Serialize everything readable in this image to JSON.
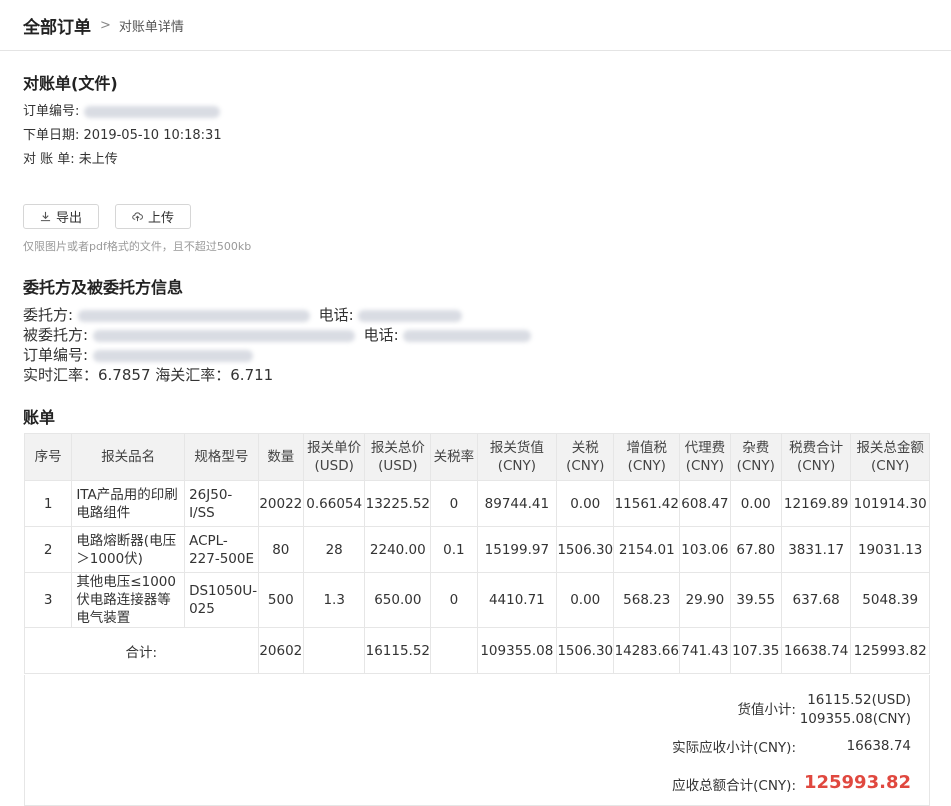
{
  "breadcrumb": {
    "root": "全部订单",
    "separator": ">",
    "current": "对账单详情"
  },
  "statement": {
    "title": "对账单(文件)",
    "order_no_label": "订单编号:",
    "order_date_label": "下单日期:",
    "order_date": "2019-05-10 10:18:31",
    "statement_label": "对 账 单:",
    "statement_status": "未上传",
    "export_label": "导出",
    "upload_label": "上传",
    "hint": "仅限图片或者pdf格式的文件，且不超过500kb"
  },
  "parties": {
    "title": "委托方及被委托方信息",
    "client_label": "委托方:",
    "client_phone_label": "电话:",
    "agent_label": "被委托方:",
    "agent_phone_label": "电话:",
    "order_no_label": "订单编号:",
    "rates": "实时汇率：6.7857  海关汇率：6.711"
  },
  "bill": {
    "title": "账单",
    "headers": [
      "序号",
      "报关品名",
      "规格型号",
      "数量",
      "报关单价(USD)",
      "报关总价(USD)",
      "关税率",
      "报关货值(CNY)",
      "关税(CNY)",
      "增值税(CNY)",
      "代理费(CNY)",
      "杂费(CNY)",
      "税费合计(CNY)",
      "报关总金额(CNY)"
    ],
    "rows": [
      [
        "1",
        "ITA产品用的印刷电路组件",
        "26J50-I/SS",
        "20022",
        "0.66054",
        "13225.52",
        "0",
        "89744.41",
        "0.00",
        "11561.42",
        "608.47",
        "0.00",
        "12169.89",
        "101914.30"
      ],
      [
        "2",
        "电路熔断器(电压＞1000伏)",
        "ACPL-227-500E",
        "80",
        "28",
        "2240.00",
        "0.1",
        "15199.97",
        "1506.30",
        "2154.01",
        "103.06",
        "67.80",
        "3831.17",
        "19031.13"
      ],
      [
        "3",
        "其他电压≤1000伏电路连接器等电气装置",
        "DS1050U-025",
        "500",
        "1.3",
        "650.00",
        "0",
        "4410.71",
        "0.00",
        "568.23",
        "29.90",
        "39.55",
        "637.68",
        "5048.39"
      ]
    ],
    "total_label": "合计:",
    "totals": {
      "qty": "20602",
      "total_usd": "16115.52",
      "goods_cny": "109355.08",
      "duty": "1506.30",
      "vat": "14283.66",
      "agency": "741.43",
      "misc": "107.35",
      "tax_total": "16638.74",
      "grand": "125993.82"
    }
  },
  "summary": {
    "goods_label": "货值小计:",
    "goods_usd": "16115.52(USD)",
    "goods_cny": "109355.08(CNY)",
    "receivable_label": "实际应收小计(CNY):",
    "receivable": "16638.74",
    "total_label": "应收总额合计(CNY):",
    "total": "125993.82"
  }
}
